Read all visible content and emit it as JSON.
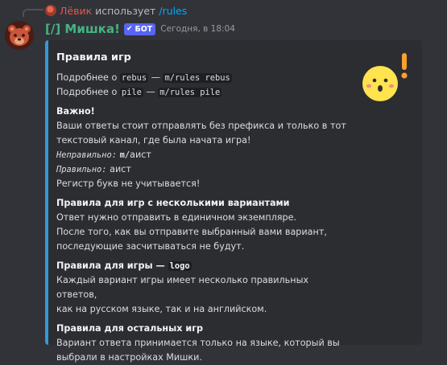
{
  "reply": {
    "user": "Лёвик",
    "text": "использует",
    "command": "/rules"
  },
  "message": {
    "bot_name": "[/] Мишка!",
    "bot_tag": "БОТ",
    "timestamp": "Сегодня, в 18:04"
  },
  "embed": {
    "accent_color": "#3498db",
    "title": "Правила игр",
    "intro": [
      {
        "prefix": "Подробнее о ",
        "game": "rebus",
        "dash": " — ",
        "command": "m/rules rebus"
      },
      {
        "prefix": "Подробнее о ",
        "game": "pile",
        "dash": " — ",
        "command": "m/rules pile"
      }
    ],
    "important": {
      "name": "Важно!",
      "lines": [
        "Ваши ответы стоит отправлять без префикса и только в тот",
        "текстовый канал, где была начата игра!"
      ],
      "wrong_label": "Неправильно:",
      "wrong_prefix": "m/",
      "wrong_word": "аист",
      "right_label": "Правильно:",
      "right_word": "аист",
      "case_note": "Регистр букв не учитывается!"
    },
    "multi": {
      "name": "Правила для игр с несколькими вариантами",
      "lines": [
        "Ответ нужно отправить в единичном экземпляре.",
        "После того, как вы отправите выбранный вами вариант,",
        "последующие засчитываться не будут."
      ]
    },
    "logo": {
      "name_prefix": "Правила для игры — ",
      "name_code": "logo",
      "lines": [
        "Каждый вариант игры имеет несколько правильных ответов,",
        "как на русском языке, так и на английском."
      ]
    },
    "others": {
      "name": "Правила для остальных игр",
      "lines": [
        "Вариант ответа принимается только на языке, который вы",
        "выбрали в настройках Мишки."
      ]
    }
  },
  "icons": {
    "reply_avatar": "user-avatar-icon",
    "bot_avatar": "bear-avatar-icon",
    "bot_check": "checkmark-icon",
    "thumbnail": "surprised-emoji-icon"
  }
}
